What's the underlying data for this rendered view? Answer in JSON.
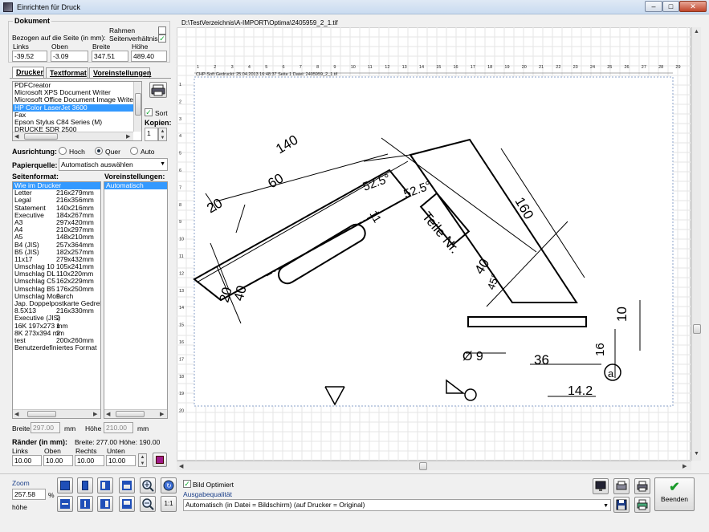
{
  "window": {
    "title": "Einrichten für Druck"
  },
  "dokument": {
    "heading": "Dokument",
    "bezogen_label": "Bezogen auf die Seite (in mm):",
    "rahmen_label": "Rahmen",
    "seitenverhaeltnis_label": "Seitenverhältnis",
    "rahmen_checked": false,
    "seitenverhaeltnis_checked": true,
    "fields": [
      {
        "label": "Links",
        "value": "-39.52"
      },
      {
        "label": "Oben",
        "value": "-3.09"
      },
      {
        "label": "Breite",
        "value": "347.51"
      },
      {
        "label": "Höhe",
        "value": "489.40"
      }
    ]
  },
  "tabs": [
    "Drucker",
    "Textformat",
    "Voreinstellungen"
  ],
  "printers": {
    "items": [
      "PDFCreator",
      "Microsoft XPS Document Writer",
      "Microsoft Office Document Image Writer",
      "HP Color LaserJet 3600",
      "Fax",
      "Epson Stylus C84 Series (M)",
      "DRUCKE SDR 2500"
    ],
    "selected_index": 3,
    "sort_label": "Sort",
    "sort_checked": true,
    "kopien_label": "Kopien:",
    "kopien_value": "1"
  },
  "ausrichtung": {
    "label": "Ausrichtung:",
    "options": [
      "Hoch",
      "Quer",
      "Auto"
    ],
    "selected": "Quer"
  },
  "papierquelle": {
    "label": "Papierquelle:",
    "value": "Automatisch auswählen"
  },
  "seitenformat": {
    "label": "Seitenformat:",
    "items": [
      {
        "name": "Wie im Drucker",
        "size": ""
      },
      {
        "name": "Letter",
        "size": "216x279mm"
      },
      {
        "name": "Legal",
        "size": "216x356mm"
      },
      {
        "name": "Statement",
        "size": "140x216mm"
      },
      {
        "name": "Executive",
        "size": "184x267mm"
      },
      {
        "name": "A3",
        "size": "297x420mm"
      },
      {
        "name": "A4",
        "size": "210x297mm"
      },
      {
        "name": "A5",
        "size": "148x210mm"
      },
      {
        "name": "B4 (JIS)",
        "size": "257x364mm"
      },
      {
        "name": "B5 (JIS)",
        "size": "182x257mm"
      },
      {
        "name": "11x17",
        "size": "279x432mm"
      },
      {
        "name": "Umschlag 10",
        "size": "105x241mm"
      },
      {
        "name": "Umschlag DL",
        "size": "110x220mm"
      },
      {
        "name": "Umschlag C5",
        "size": "162x229mm"
      },
      {
        "name": "Umschlag B5",
        "size": "176x250mm"
      },
      {
        "name": "Umschlag Monarch",
        "size": "9"
      },
      {
        "name": "Jap. Doppelpostkarte Gedreht",
        "size": ""
      },
      {
        "name": "8.5X13",
        "size": "216x330mm"
      },
      {
        "name": "Executive (JIS)",
        "size": "2"
      },
      {
        "name": "16K 197x273 mm",
        "size": "1"
      },
      {
        "name": "8K 273x394 mm",
        "size": "2"
      },
      {
        "name": "test",
        "size": "200x260mm"
      },
      {
        "name": "Benutzerdefiniertes Format",
        "size": ""
      }
    ],
    "selected_index": 0
  },
  "voreinstellungen": {
    "label": "Voreinstellungen:",
    "items": [
      "Automatisch"
    ],
    "selected_index": 0
  },
  "page_size": {
    "breite_label": "Breite",
    "breite_value": "297.00",
    "hoehe_label": "Höhe",
    "hoehe_value": "210.00",
    "unit": "mm"
  },
  "raender": {
    "label": "Ränder (in mm):",
    "info": "Breite: 277.00  Höhe: 190.00",
    "fields": [
      {
        "label": "Links",
        "value": "10.00"
      },
      {
        "label": "Oben",
        "value": "10.00"
      },
      {
        "label": "Rechts",
        "value": "10.00"
      },
      {
        "label": "Unten",
        "value": "10.00"
      }
    ]
  },
  "preview": {
    "path": "D:\\TestVerzeichnis\\A-IMPORT\\Optima\\2405959_2_1.tif",
    "header_line": "CHP-Soft   Gedruckt: 25.04.2013 16:48:37   Seite 1   Datei: 2405959_2_1.tif",
    "ruler_top": [
      "1",
      "2",
      "3",
      "4",
      "5",
      "6",
      "7",
      "8",
      "9",
      "10",
      "11",
      "12",
      "13",
      "14",
      "15",
      "16",
      "17",
      "18",
      "19",
      "20",
      "21",
      "22",
      "23",
      "24",
      "25",
      "26",
      "27",
      "28",
      "29"
    ],
    "ruler_left": [
      "1",
      "2",
      "3",
      "4",
      "5",
      "6",
      "7",
      "8",
      "9",
      "10",
      "11",
      "12",
      "13",
      "14",
      "15",
      "16",
      "17",
      "18",
      "19",
      "20"
    ],
    "drawing_labels": [
      "140",
      "60",
      "20",
      "11",
      "52.5°",
      "52.5°",
      "160",
      "Teile Nr.",
      "40",
      "20",
      "40",
      "45°",
      "10",
      "Ø 9",
      "36",
      "16",
      "a",
      "14.2"
    ]
  },
  "bottom": {
    "zoom_label": "Zoom",
    "zoom_value": "257.58",
    "zoom_unit": "%",
    "hoehe_label": "höhe",
    "one_to_one": "1:1",
    "bild_optimiert_label": "Bild Optimiert",
    "bild_optimiert_checked": true,
    "ausgabe_label": "Ausgabequalität",
    "ausgabe_value": "Automatisch (in Datei = Bildschirm) (auf Drucker = Original)",
    "beenden_label": "Beenden"
  }
}
